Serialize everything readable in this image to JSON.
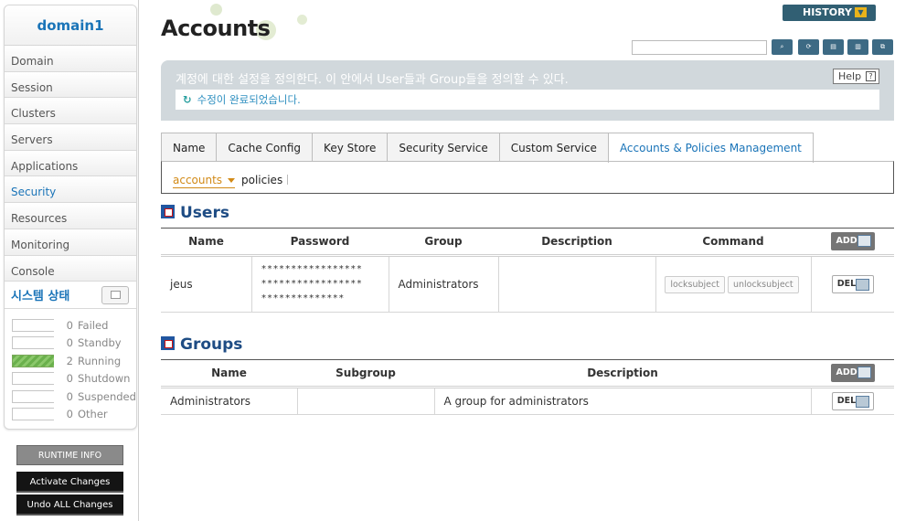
{
  "sidebar": {
    "domain": "domain1",
    "nav": [
      "Domain",
      "Session",
      "Clusters",
      "Servers",
      "Applications",
      "Security",
      "Resources",
      "Monitoring",
      "Console"
    ],
    "active_nav": "Security",
    "system_status_title": "시스템 상태",
    "status": [
      {
        "count": "0",
        "label": "Failed"
      },
      {
        "count": "0",
        "label": "Standby"
      },
      {
        "count": "2",
        "label": "Running"
      },
      {
        "count": "0",
        "label": "Shutdown"
      },
      {
        "count": "0",
        "label": "Suspended"
      },
      {
        "count": "0",
        "label": "Other"
      }
    ],
    "runtime_info": "RUNTIME INFO",
    "activate_changes": "Activate Changes",
    "undo_changes": "Undo ALL Changes"
  },
  "header": {
    "title": "Accounts",
    "history": "HISTORY",
    "search_value": "",
    "toolbar_icons": [
      "search-icon",
      "refresh-icon",
      "xml-export-icon",
      "xml-import-icon",
      "copy-icon"
    ]
  },
  "description": {
    "text": "계정에 대한 설정을 정의한다. 이 안에서 User들과 Group들을 정의할 수 있다.",
    "help": "Help",
    "message": "수정이 완료되었습니다."
  },
  "tabs": [
    "Name",
    "Cache Config",
    "Key Store",
    "Security Service",
    "Custom Service",
    "Accounts & Policies Management"
  ],
  "active_tab": "Accounts & Policies Management",
  "subtabs": {
    "accounts": "accounts",
    "policies": "policies"
  },
  "users": {
    "title": "Users",
    "columns": [
      "Name",
      "Password",
      "Group",
      "Description",
      "Command"
    ],
    "add": "ADD",
    "rows": [
      {
        "name": "jeus",
        "password_lines": [
          "*****************",
          "*****************",
          "**************"
        ],
        "group": "Administrators",
        "description": "",
        "commands": [
          "locksubject",
          "unlocksubject"
        ],
        "del": "DEL"
      }
    ]
  },
  "groups": {
    "title": "Groups",
    "columns": [
      "Name",
      "Subgroup",
      "Description"
    ],
    "add": "ADD",
    "rows": [
      {
        "name": "Administrators",
        "subgroup": "",
        "description": "A group for administrators",
        "del": "DEL"
      }
    ]
  }
}
